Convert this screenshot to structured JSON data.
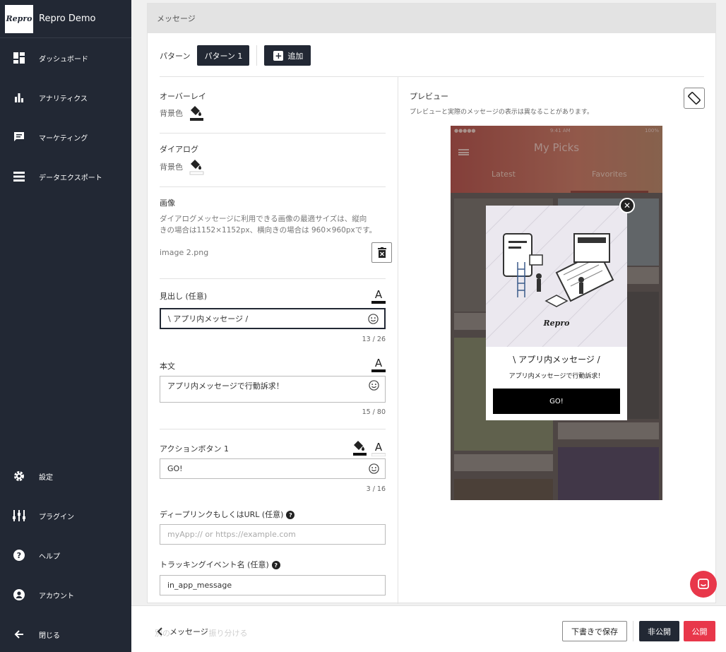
{
  "app": {
    "logo_text": "Repro",
    "name": "Repro Demo"
  },
  "sidebar": {
    "items": [
      {
        "label": "ダッシュボード",
        "icon": "dashboard-icon"
      },
      {
        "label": "アナリティクス",
        "icon": "bar-chart-icon"
      },
      {
        "label": "マーケティング",
        "icon": "chat-icon"
      },
      {
        "label": "データエクスポート",
        "icon": "list-icon"
      }
    ],
    "bottom_items": [
      {
        "label": "設定",
        "icon": "gear-icon"
      },
      {
        "label": "プラグイン",
        "icon": "plugin-icon"
      },
      {
        "label": "ヘルプ",
        "icon": "help-icon"
      },
      {
        "label": "アカウント",
        "icon": "account-icon"
      },
      {
        "label": "閉じる",
        "icon": "arrow-left-icon"
      }
    ]
  },
  "section": {
    "title": "メッセージ"
  },
  "patterns": {
    "label": "パターン",
    "active": "パターン 1",
    "add_label": "追加"
  },
  "form": {
    "overlay": {
      "title": "オーバーレイ",
      "bg_label": "背景色"
    },
    "dialog": {
      "title": "ダイアログ",
      "bg_label": "背景色"
    },
    "image": {
      "title": "画像",
      "help_line1": "ダイアログメッセージに利用できる画像の最適サイズは、縦向",
      "help_line2": "きの場合は1152×1152px、横向きの場合は 960×960pxです。",
      "filename": "image 2.png"
    },
    "heading": {
      "title": "見出し (任意)",
      "value": "\\ アプリ内メッセージ /",
      "counter": "13 / 26"
    },
    "body": {
      "title": "本文",
      "value": "アプリ内メッセージで行動訴求！",
      "counter": "15 / 80"
    },
    "action1": {
      "title": "アクションボタン 1",
      "value": "GO!",
      "counter": "3 / 16"
    },
    "deeplink": {
      "title": "ディープリンクもしくはURL (任意)",
      "placeholder": "myApp:// or https://example.com"
    },
    "tracking": {
      "title": "トラッキングイベント名 (任意)",
      "value": "in_app_message"
    }
  },
  "preview": {
    "title": "プレビュー",
    "note": "プレビューと実際のメッセージの表示は異なることがあります。",
    "phone": {
      "status_left": "●●●●● ",
      "status_center": "9:41 AM",
      "status_right": "100%",
      "app_title": "My Picks",
      "tab_left": "Latest",
      "tab_right": "Favorites",
      "dialog_logo": "Repro",
      "dialog_heading": "\\ アプリ内メッセージ /",
      "dialog_body": "アプリ内メッセージで行動訴求！",
      "dialog_button": "GO!"
    }
  },
  "footer": {
    "back_label": "メッセージ",
    "ghost_label": "別のパターンに振り分ける",
    "save_draft": "下書きで保存",
    "unpublish": "非公開",
    "publish": "公開"
  },
  "colors": {
    "sidebar": "#222834",
    "accent": "#e8374a",
    "dark_button": "#222834"
  }
}
